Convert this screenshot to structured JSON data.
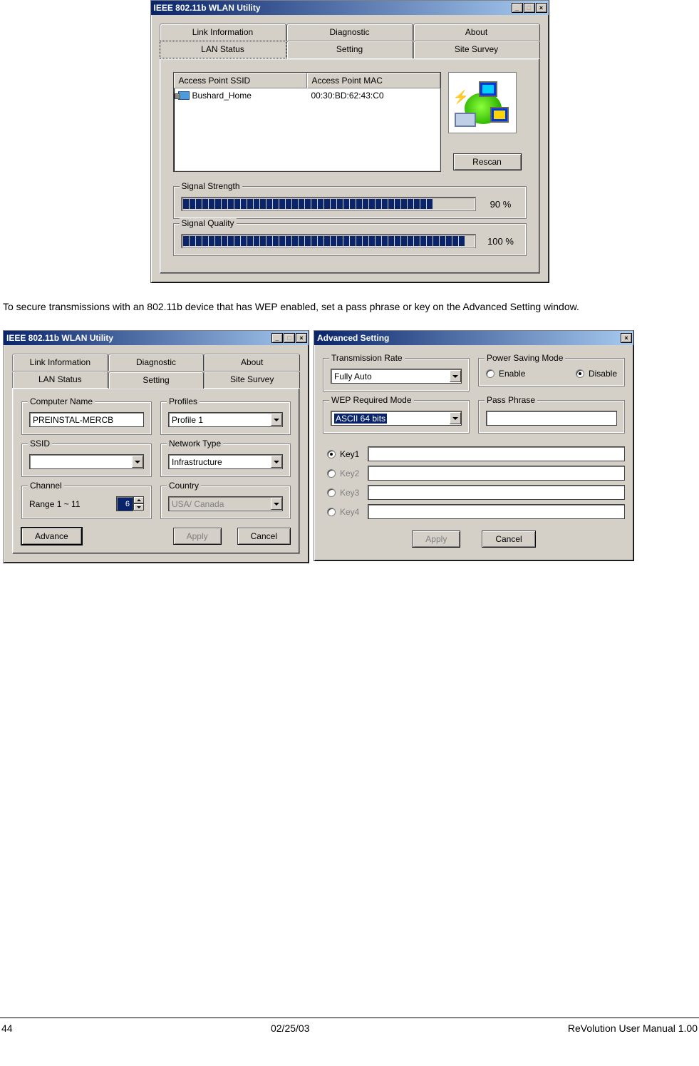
{
  "win1": {
    "title": "IEEE 802.11b WLAN Utility",
    "tabs_back": [
      "Link Information",
      "Diagnostic",
      "About"
    ],
    "tabs_front": [
      "LAN Status",
      "Setting",
      "Site Survey"
    ],
    "active_tab": "LAN Status",
    "list_headers": [
      "Access Point SSID",
      "Access Point MAC"
    ],
    "list_rows": [
      {
        "ssid": "Bushard_Home",
        "mac": "00:30:BD:62:43:C0"
      }
    ],
    "rescan": "Rescan",
    "signal_strength": {
      "label": "Signal Strength",
      "pct": "90 %",
      "segments": 39
    },
    "signal_quality": {
      "label": "Signal Quality",
      "pct": "100 %",
      "segments": 44
    }
  },
  "para": "To secure transmissions with an 802.11b device that has WEP enabled, set a pass phrase or key on the Advanced Setting window.",
  "win2": {
    "title": "IEEE 802.11b WLAN Utility",
    "tabs_back": [
      "Link Information",
      "Diagnostic",
      "About"
    ],
    "tabs_front": [
      "LAN Status",
      "Setting",
      "Site Survey"
    ],
    "active_tab": "Setting",
    "computer_name": {
      "label": "Computer Name",
      "value": "PREINSTAL-MERCB"
    },
    "profiles": {
      "label": "Profiles",
      "value": "Profile 1"
    },
    "ssid": {
      "label": "SSID",
      "value": ""
    },
    "nettype": {
      "label": "Network Type",
      "value": "Infrastructure"
    },
    "channel": {
      "label": "Channel",
      "range": "Range 1 ~ 11",
      "value": "6"
    },
    "country": {
      "label": "Country",
      "value": "USA/ Canada"
    },
    "advance": "Advance",
    "apply": "Apply",
    "cancel": "Cancel"
  },
  "win3": {
    "title": "Advanced Setting",
    "tx": {
      "label": "Transmission Rate",
      "value": "Fully Auto"
    },
    "psm": {
      "label": "Power Saving Mode",
      "enable": "Enable",
      "disable": "Disable",
      "selected": "Disable"
    },
    "wep": {
      "label": "WEP Required Mode",
      "value": "ASCII 64 bits"
    },
    "pp": {
      "label": "Pass Phrase",
      "value": ""
    },
    "keys": [
      "Key1",
      "Key2",
      "Key3",
      "Key4"
    ],
    "apply": "Apply",
    "cancel": "Cancel"
  },
  "footer": {
    "page": "44",
    "date": "02/25/03",
    "manual": "ReVolution User Manual 1.00"
  }
}
